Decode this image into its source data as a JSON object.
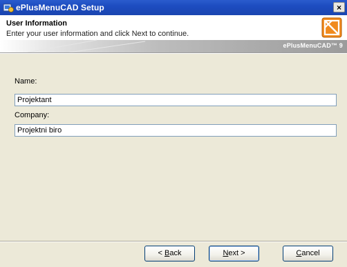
{
  "window": {
    "title": "ePlusMenuCAD Setup",
    "close_glyph": "×"
  },
  "header": {
    "title": "User Information",
    "subtitle": "Enter your user information and click Next to continue.",
    "product_label": "ePlusMenuCAD™ 9"
  },
  "form": {
    "name_label": "Name:",
    "name_value": "Projektant",
    "company_label": "Company:",
    "company_value": "Projektni biro"
  },
  "buttons": {
    "back_prefix": "< ",
    "back_key": "B",
    "back_rest": "ack",
    "next_key": "N",
    "next_rest": "ext >",
    "cancel_key": "C",
    "cancel_rest": "ancel"
  },
  "colors": {
    "titlebar": "#1d4cc0",
    "logo_orange": "#f08a1e",
    "dialog_bg": "#ece9d8"
  },
  "icons": {
    "title": "installer-icon",
    "logo": "eplus-logo-icon"
  }
}
